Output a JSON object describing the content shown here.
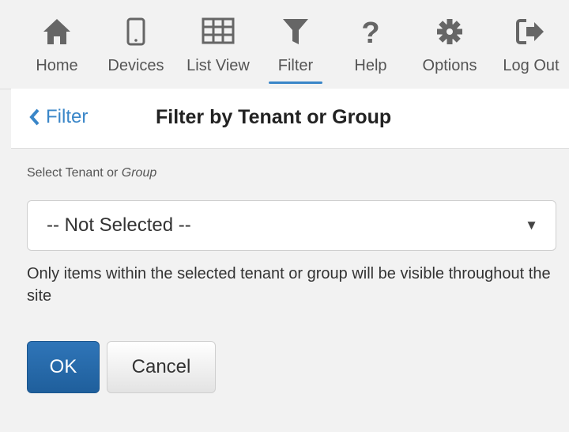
{
  "nav": {
    "items": [
      {
        "label": "Home",
        "icon": "home-icon"
      },
      {
        "label": "Devices",
        "icon": "mobile-device-icon"
      },
      {
        "label": "List View",
        "icon": "list-grid-icon"
      },
      {
        "label": "Filter",
        "icon": "filter-icon",
        "active": true
      },
      {
        "label": "Help",
        "icon": "question-icon"
      },
      {
        "label": "Options",
        "icon": "gear-icon"
      },
      {
        "label": "Log Out",
        "icon": "logout-icon"
      }
    ],
    "active_color": "#3a86c8"
  },
  "page": {
    "back_label": "Filter",
    "title": "Filter by Tenant or Group"
  },
  "form": {
    "label_prefix": "Select Tenant or ",
    "label_italic": "Group",
    "select_value": "-- Not Selected --",
    "help_text": "Only items within the selected tenant or group will be visible throughout the site",
    "ok_label": "OK",
    "cancel_label": "Cancel",
    "primary_color": "#2a6db0"
  }
}
